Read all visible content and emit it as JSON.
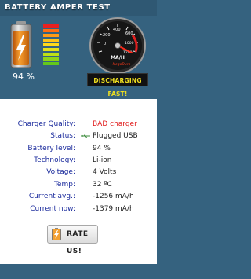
{
  "header": {
    "title": "BATTERY AMPER TEST"
  },
  "battery": {
    "percent_text": "94 %",
    "level": 0.94
  },
  "gauge": {
    "ticks": [
      "0",
      "200",
      "400",
      "600",
      "1000",
      "1200"
    ],
    "unit": "MA/H",
    "brand": "NegoDuro",
    "status_text": "DISCHARGING FAST!"
  },
  "info": [
    {
      "label": "Charger Quality:",
      "value": "BAD charger"
    },
    {
      "label": "Status:",
      "value": "Plugged USB"
    },
    {
      "label": "Battery level:",
      "value": "94 %"
    },
    {
      "label": "Technology:",
      "value": "Li-ion"
    },
    {
      "label": "Voltage:",
      "value": "4 Volts"
    },
    {
      "label": "Temp:",
      "value": "32 ºC"
    },
    {
      "label": "Current avg.:",
      "value": "-1256 mA/h"
    },
    {
      "label": "Current now:",
      "value": "-1379 mA/h"
    }
  ],
  "rate_button": {
    "label": "RATE US!"
  },
  "colors": {
    "background": "#35627f",
    "label_blue": "#1a2a9c",
    "bad_red": "#e01818",
    "banner_yellow": "#f0e020"
  }
}
